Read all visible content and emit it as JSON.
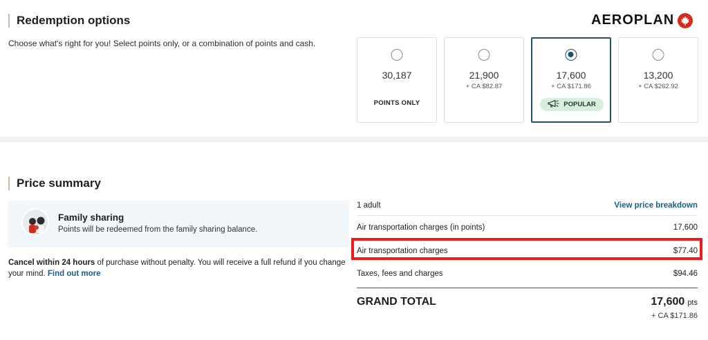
{
  "redemption": {
    "title": "Redemption options",
    "subtitle": "Choose what's right for you! Select points only, or a combination of points and cash.",
    "options": [
      {
        "points": "30,187",
        "cash": "",
        "tag": "POINTS ONLY",
        "selected": false
      },
      {
        "points": "21,900",
        "cash": "+ CA $82.87",
        "tag": "",
        "selected": false
      },
      {
        "points": "17,600",
        "cash": "+ CA $171.86",
        "tag": "POPULAR",
        "selected": true
      },
      {
        "points": "13,200",
        "cash": "+ CA $262.92",
        "tag": "",
        "selected": false
      }
    ]
  },
  "brand": {
    "logo_text": "AEROPLAN",
    "leaf_color": "#d52b1e"
  },
  "price_summary": {
    "title": "Price summary",
    "family_sharing": {
      "title": "Family sharing",
      "description": "Points will be redeemed from the family sharing balance."
    },
    "cancel": {
      "bold": "Cancel within 24 hours",
      "text": " of purchase without penalty. You will receive a full refund if you change your mind. ",
      "link": "Find out more"
    },
    "passengers": "1 adult",
    "breakdown_link": "View price breakdown",
    "rows": [
      {
        "label": "Air transportation charges (in points)",
        "value": "17,600"
      },
      {
        "label": "Air transportation charges",
        "value": "$77.40"
      },
      {
        "label": "Taxes, fees and charges",
        "value": "$94.46"
      }
    ],
    "grand_total": {
      "label": "GRAND TOTAL",
      "points": "17,600",
      "points_unit": "pts",
      "cash": "+ CA $171.86"
    }
  },
  "colors": {
    "accent": "#1d4f6b",
    "link": "#1b5e86",
    "highlight": "#ee1c1c",
    "popular_bg": "#d7eedd"
  },
  "icons": {
    "popular": "megaphone-icon",
    "brand": "maple-leaf-icon"
  }
}
